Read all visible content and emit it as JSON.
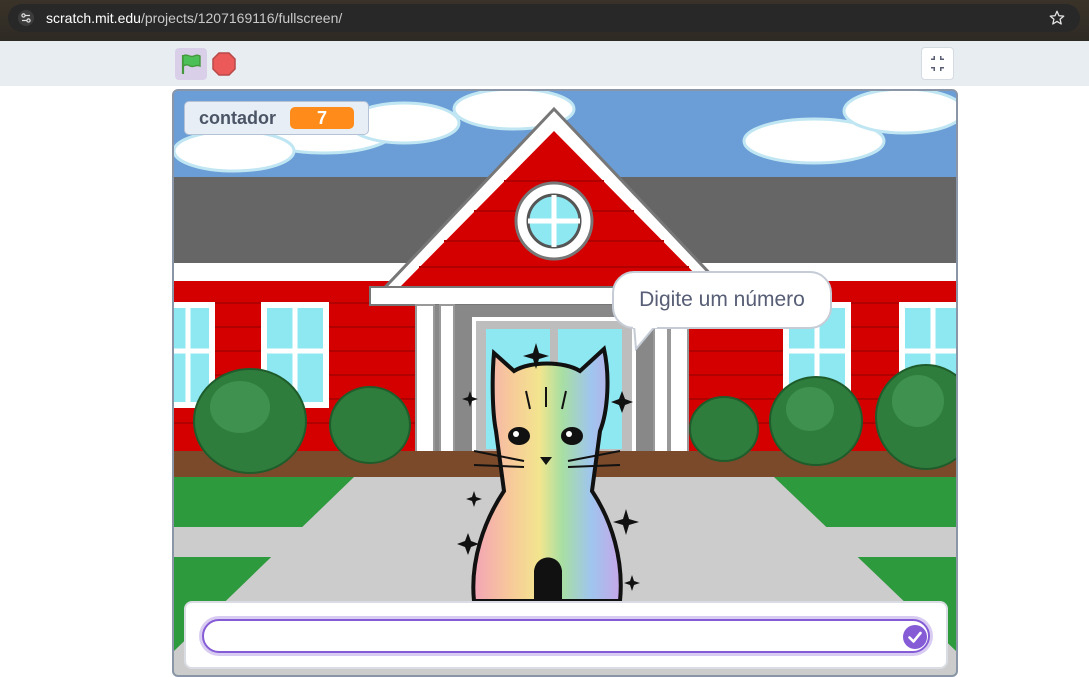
{
  "browser": {
    "url_host": "scratch.mit.edu",
    "url_path": "/projects/1207169116/fullscreen/",
    "icons": [
      "site-info-icon",
      "star-icon"
    ]
  },
  "controls": {
    "icons": [
      "green-flag-icon",
      "stop-icon",
      "unfullscreen-icon"
    ]
  },
  "stage": {
    "variable_monitor": {
      "name": "contador",
      "value": "7"
    },
    "speech": "Digite um número",
    "ask": {
      "value": "",
      "submit_icon": "check-icon"
    },
    "colors": {
      "monitor_value": "#ff8c1a",
      "accent": "#855cd6",
      "house_red": "#d40000"
    }
  }
}
